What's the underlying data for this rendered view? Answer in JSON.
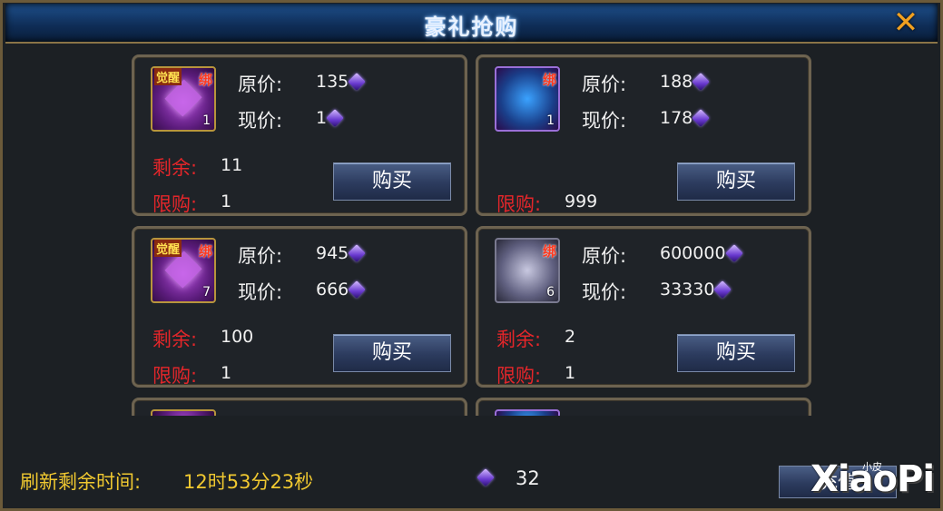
{
  "title": "豪礼抢购",
  "labels": {
    "original_price": "原价:",
    "current_price": "现价:",
    "remaining": "剩余:",
    "limit": "限购:",
    "buy": "购买"
  },
  "items": [
    {
      "tag": "觉醒",
      "bind": "绑",
      "count": "1",
      "original": "135",
      "current": "1",
      "remaining": "11",
      "limit": "1",
      "icon": "purple-gem-icon"
    },
    {
      "tag": "",
      "bind": "绑",
      "count": "1",
      "original": "188",
      "current": "178",
      "remaining": null,
      "limit": "999",
      "icon": "blue-chest-icon"
    },
    {
      "tag": "觉醒",
      "bind": "绑",
      "count": "7",
      "original": "945",
      "current": "666",
      "remaining": "100",
      "limit": "1",
      "icon": "purple-gem-icon"
    },
    {
      "tag": "",
      "bind": "绑",
      "count": "6",
      "original": "600000",
      "current": "33330",
      "remaining": "2",
      "limit": "1",
      "icon": "silver-chest-icon"
    }
  ],
  "footer": {
    "refresh_label": "刷新剩余时间:",
    "refresh_time": "12时53分23秒",
    "currency_amount": "32",
    "recharge_label": "充值"
  },
  "watermark": {
    "text": "XiaoPi",
    "small": "小皮"
  },
  "colors": {
    "accent_red": "#e4262a",
    "footer_yellow": "#f0c830",
    "close_orange": "#f0a020"
  }
}
